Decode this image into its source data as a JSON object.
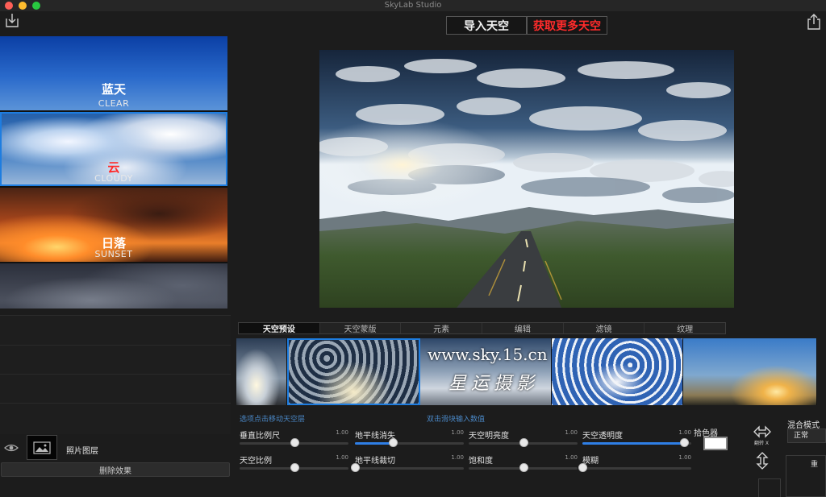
{
  "app": {
    "title": "SkyLab Studio"
  },
  "toolbar": {
    "import_sky": "导入天空",
    "more_skies": "获取更多天空"
  },
  "icons": {
    "import": "import-icon",
    "share": "share-icon",
    "eye": "eye-icon",
    "image": "image-icon",
    "flip_horizontal": "flip-horizontal-icon",
    "flip_vertical": "flip-vertical-icon"
  },
  "sky_categories": [
    {
      "cn": "蓝天",
      "en": "CLEAR"
    },
    {
      "cn": "云",
      "en": "CLOUDY"
    },
    {
      "cn": "日落",
      "en": "SUNSET"
    },
    {
      "cn": "",
      "en": ""
    }
  ],
  "layer": {
    "name": "照片图层",
    "remove_label": "删除效果"
  },
  "tabs": [
    "天空预设",
    "天空蒙版",
    "元素",
    "编辑",
    "滤镜",
    "纹理"
  ],
  "active_tab": "天空预设",
  "watermark": {
    "url": "www.sky.15.cn",
    "name": "星运摄影"
  },
  "hints": {
    "left": "选项点击移动天空层",
    "right": "双击滑块输入数值"
  },
  "sliders": {
    "vertical_scale": {
      "label": "垂直比例尺",
      "value": "1.00",
      "level": 0.5
    },
    "sky_scale": {
      "label": "天空比例",
      "value": "1.00",
      "level": 0.5
    },
    "horizon_fade": {
      "label": "地平线消失",
      "value": "1.00",
      "level": 0.35
    },
    "horizon_crop": {
      "label": "地平线裁切",
      "value": "1.00",
      "level": 0.0
    },
    "sky_brightness": {
      "label": "天空明亮度",
      "value": "1.00",
      "level": 0.5
    },
    "saturation": {
      "label": "饱和度",
      "value": "1.00",
      "level": 0.5
    },
    "sky_opacity": {
      "label": "天空透明度",
      "value": "1.00",
      "level": 0.93
    },
    "blur": {
      "label": "模糊",
      "value": "1.00",
      "level": 0.0
    }
  },
  "color_picker": {
    "label": "拾色器",
    "color": "#ffffff"
  },
  "flip": {
    "label": "翻转 X"
  },
  "blend": {
    "label": "混合模式",
    "value": "正常",
    "extra": "重"
  },
  "colors": {
    "accent": "#1e7de0",
    "more_skies_text": "#ff2b2b",
    "hint": "#4a88c7"
  }
}
